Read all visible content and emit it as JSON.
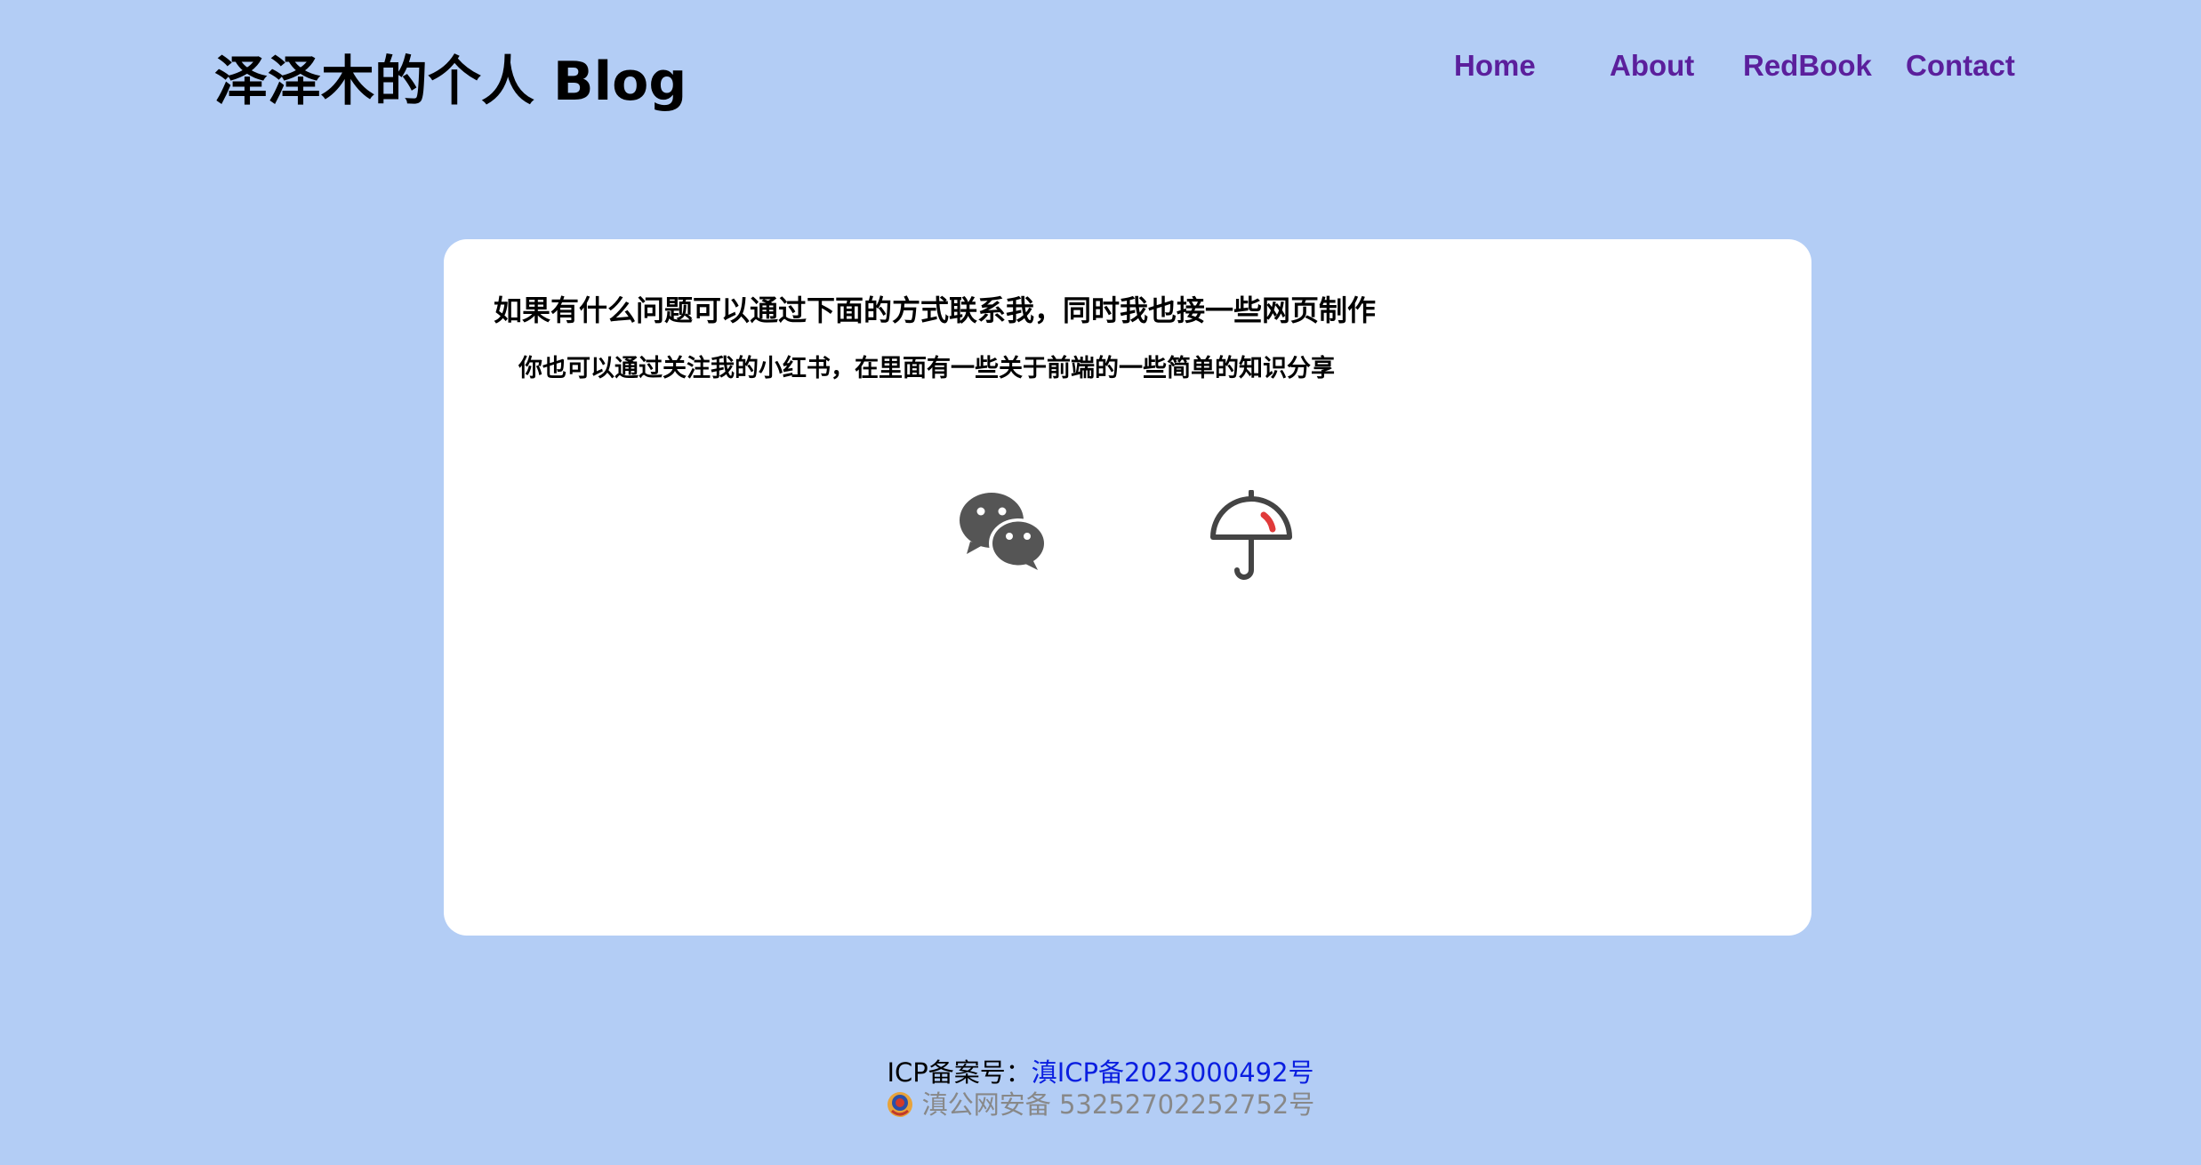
{
  "header": {
    "site_title": "泽泽木的个人 Blog"
  },
  "nav": {
    "items": [
      {
        "label": "Home"
      },
      {
        "label": "About"
      },
      {
        "label": "RedBook"
      },
      {
        "label": "Contact"
      }
    ]
  },
  "contact_card": {
    "heading": "如果有什么问题可以通过下面的方式联系我，同时我也接一些网页制作",
    "subheading": "你也可以通过关注我的小红书，在里面有一些关于前端的一些简单的知识分享",
    "icons": [
      {
        "icon": "wechat-icon"
      },
      {
        "icon": "umbrella-icon"
      }
    ]
  },
  "footer": {
    "icp_label": "ICP备案号：",
    "icp_number": "滇ICP备2023000492号",
    "police_record": "滇公网安备 53252702252752号"
  },
  "colors": {
    "background": "#b3cdf5",
    "nav_link": "#5b1f9c",
    "icp_link": "#0a1ee0",
    "icon_gray": "#555555",
    "icon_accent": "#e03a3a"
  }
}
